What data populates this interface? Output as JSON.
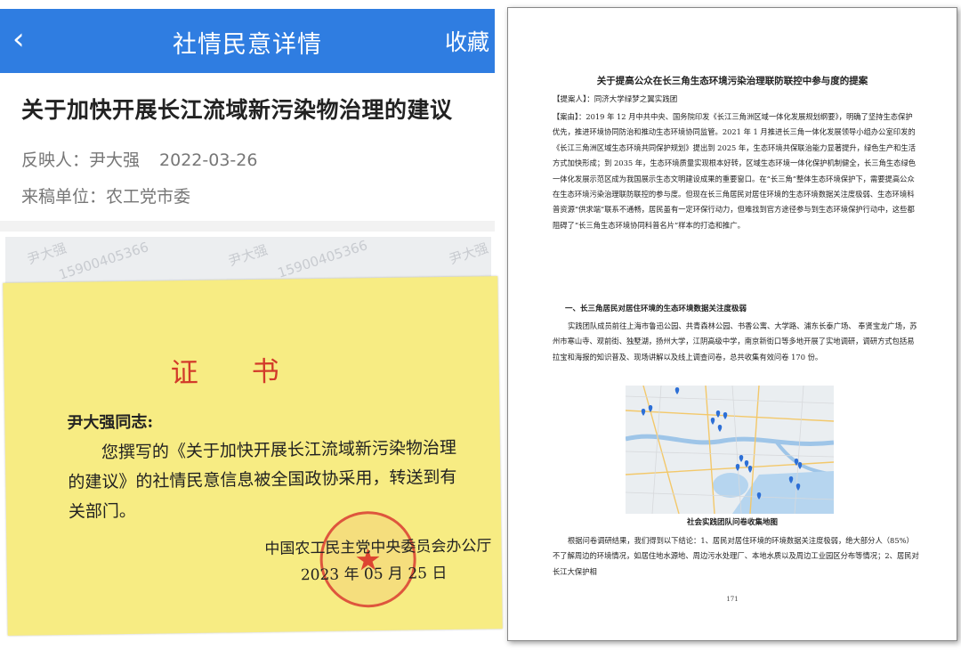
{
  "app": {
    "back_icon": "chevron-left-icon",
    "nav_title": "社情民意详情",
    "favorite_label": "收藏",
    "accent_color": "#2f7de1"
  },
  "article": {
    "title": "关于加快开展长江流域新污染物治理的建议",
    "reporter_label": "反映人：",
    "reporter_name": "尹大强",
    "date": "2022-03-26",
    "unit_label": "来稿单位：",
    "unit_name": "农工党市委"
  },
  "watermark": {
    "name": "尹大强",
    "phone": "15900405366"
  },
  "certificate": {
    "title": "证书",
    "addressee": "尹大强同志:",
    "body": "您撰写的《关于加快开展长江流域新污染物治理的建议》的社情民意信息被全国政协采用，转送到有关部门。",
    "issuer": "中国农工民主党中央委员会办公厅",
    "date": "2023 年 05 月 25 日",
    "paper_color": "#f7ec83",
    "seal_color": "#d72828"
  },
  "document": {
    "title": "关于提高公众在长三角生态环境污染治理联防联控中参与度的提案",
    "proposer": "【提案人】：同济大学绿梦之翼实践团",
    "reason": "【案由】：2019 年 12 月中共中央、国务院印发《长江三角洲区域一体化发展规划纲要》，明确了坚持生态保护优先，推进环境协同防治和推动生态环境协同监管。2021 年 1 月推进长三角一体化发展领导小组办公室印发的《长江三角洲区域生态环境共同保护规划》提出到 2025 年，生态环境共保联治能力显著提升，绿色生产和生活方式加快形成；到 2035 年，生态环境质量实现根本好转，区域生态环境一体化保护机制健全，长三角生态绿色一体化发展示范区成为我国展示生态文明建设成果的重要窗口。在“长三角”整体生态环境保护下，需要提高公众在生态环境污染治理联防联控的参与度。但现在长三角居民对居住环境的生态环境数据关注度极弱、生态环境科普资源“供求端”联系不通畅，居民虽有一定环保行动力，但难找到官方途径参与到生态环境保护行动中，这些都阻碍了“长三角生态环境协同科普名片”样本的打造和推广。",
    "heading1": "一、长三角居民对居住环境的生态环境数据关注度极弱",
    "para2": "实践团队成员前往上海市鲁迅公园、共青森林公园、书香公寓、大学路、浦东长泰广场、 奉贤宝龙广场，苏州市寒山寺、观前街、独墅湖，扬州大学，江阴高级中学，南京新街口等多地开展了实地调研，调研方式包括易拉宝和海报的知识普及、现场讲解以及线上调查问卷，总共收集有效问卷 170 份。",
    "map_caption": "社会实践团队问卷收集地图",
    "para3": "根据问卷调研结果，我们得到以下结论：1、居民对居住环境的环境数据关注度极弱，绝大部分人（85%）不了解周边的环境情况，如居住地水源地、周边污水处理厂、本地水质以及周边工业园区分布等情况；2、居民对长江大保护相",
    "page_number": "171",
    "marker_icon": "map-pin-icon",
    "marker_color": "#2d6fd6"
  }
}
